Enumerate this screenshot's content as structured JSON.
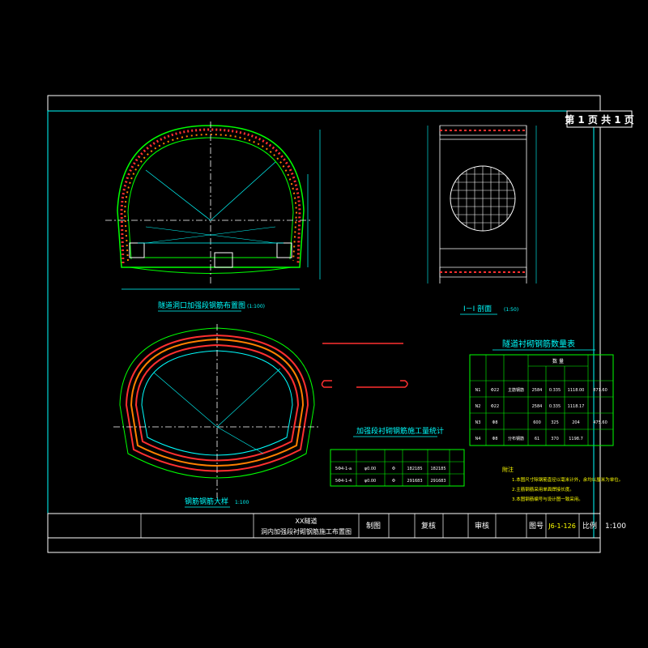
{
  "colors": {
    "background": "#000000",
    "frame": "#ffffff",
    "inner_frame": "#00ffff",
    "lining_green": "#00ff00",
    "lining_red": "#ff3030",
    "lining_orange": "#ff8000",
    "dim_cyan": "#00ffff",
    "text_cyan": "#00ffff",
    "mesh_white": "#ffffff",
    "title_yellow": "#ffff00",
    "magenta": "#ff00ff"
  },
  "page_counter": "第 1 页 共 1 页",
  "views": {
    "top_left_caption": "隧道洞口加强段钢筋布置图",
    "top_left_scale": "(1:100)",
    "bottom_left_caption": "钢筋钢筋大样",
    "bottom_left_scale": "1:100",
    "section_caption": "I－I 剖面",
    "section_scale": "(1:50)"
  },
  "table_right": {
    "title": "隧道衬砌钢筋数量表",
    "header_group": "数 量",
    "rows": [
      [
        "N1",
        "Φ22",
        "主筋钢筋",
        "2584",
        "0.335",
        "1118.00",
        "871.60"
      ],
      [
        "N2",
        "Φ22",
        "",
        "2584",
        "0.335",
        "1118.17",
        ""
      ],
      [
        "N3",
        "Φ8",
        "",
        "600",
        "325",
        "204",
        "475.60"
      ],
      [
        "N4",
        "Φ8",
        "分布钢筋",
        "61",
        "370",
        "1198.7",
        ""
      ]
    ]
  },
  "table_mid": {
    "title": "加强段衬砌钢筋施工量统计",
    "rows": [
      [
        "5Φ4-1-a",
        "φ0.00",
        "Φ",
        "182185",
        "182185"
      ],
      [
        "5Φ4-1-4",
        "φ0.00",
        "Φ",
        "291683",
        "291683"
      ]
    ]
  },
  "notes": {
    "title": "附注",
    "items": [
      "1.本图尺寸除钢筋直径以毫米计外，余均以厘米为单位。",
      "2.主筋钢筋采用单面焊接长度。",
      "3.本图钢筋编号与设计图一致采用。"
    ]
  },
  "title_block": {
    "project": "XX隧道",
    "drawing_name": "洞内加强段衬砌钢筋施工布置图",
    "drawn_label": "制图",
    "review_label": "复核",
    "check_label": "审核",
    "drawing_no_label": "图号",
    "drawing_no": "J6-1-126",
    "scale_label": "比例",
    "scale_value": "1:100"
  }
}
